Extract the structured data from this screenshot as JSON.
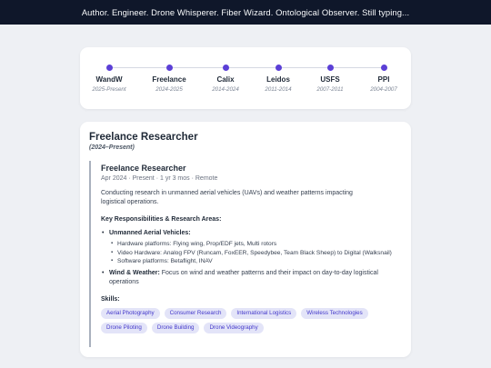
{
  "header": {
    "tagline": "Author. Engineer. Drone Whisperer. Fiber Wizard. Ontological Observer. Still typing..."
  },
  "timeline": {
    "items": [
      {
        "name": "WandW",
        "years": "2025-Present"
      },
      {
        "name": "Freelance",
        "years": "2024-2025"
      },
      {
        "name": "Calix",
        "years": "2014-2024"
      },
      {
        "name": "Leidos",
        "years": "2011-2014"
      },
      {
        "name": "USFS",
        "years": "2007-2011"
      },
      {
        "name": "PPI",
        "years": "2004-2007"
      }
    ]
  },
  "detail": {
    "title": "Freelance Researcher",
    "period": "(2024–Present)",
    "entry": {
      "title": "Freelance Researcher",
      "meta": "Apr 2024 · Present · 1 yr 3 mos · Remote",
      "description": "Conducting research in unmanned aerial vehicles (UAVs) and weather patterns impacting logistical operations.",
      "responsibilities_heading": "Key Responsibilities & Research Areas:",
      "uav": {
        "label": "Unmanned Aerial Vehicles:",
        "items": [
          "Hardware platforms: Flying wing, Prop/EDF jets, Multi rotors",
          "Video Hardware: Analog FPV (Runcam, FoxEER, Speedybee, Team Black Sheep) to Digital (Walksnail)",
          "Software platforms: Betaflight, INAV"
        ]
      },
      "weather": {
        "label": "Wind & Weather:",
        "text": "Focus on wind and weather patterns and their impact on day-to-day logistical operations"
      },
      "skills_heading": "Skills:",
      "skills": [
        "Aerial Photography",
        "Consumer Research",
        "International Logistics",
        "Wireless Technologies",
        "Drone Piloting",
        "Drone Building",
        "Drone Videography"
      ]
    }
  }
}
